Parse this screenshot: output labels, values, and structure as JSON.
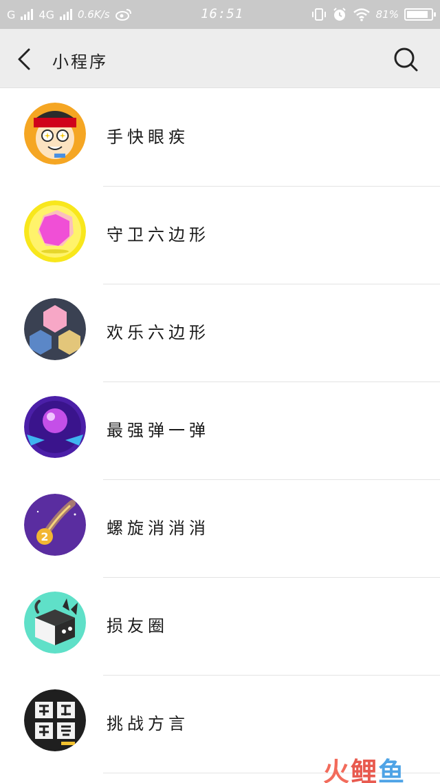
{
  "status_bar": {
    "carrier_1": "G",
    "carrier_2": "4G",
    "net_speed": "0.6K/s",
    "time": "16:51",
    "battery": "81%",
    "battery_level": 0.81
  },
  "header": {
    "title": "小程序",
    "back_icon": "chevron-left-icon",
    "search_icon": "search-icon"
  },
  "items": [
    {
      "label": "手快眼疾",
      "icon": "cartoon-face-avatar"
    },
    {
      "label": "守卫六边形",
      "icon": "pink-hexagon-avatar"
    },
    {
      "label": "欢乐六边形",
      "icon": "three-hexagons-avatar"
    },
    {
      "label": "最强弹一弹",
      "icon": "purple-ball-avatar"
    },
    {
      "label": "螺旋消消消",
      "icon": "spiral-comet-avatar"
    },
    {
      "label": "损友圈",
      "icon": "cat-cube-avatar"
    },
    {
      "label": "挑战方言",
      "icon": "dialect-challenge-avatar"
    }
  ],
  "watermark": {
    "part1": "火",
    "part2": "鲤",
    "part3": "鱼"
  }
}
